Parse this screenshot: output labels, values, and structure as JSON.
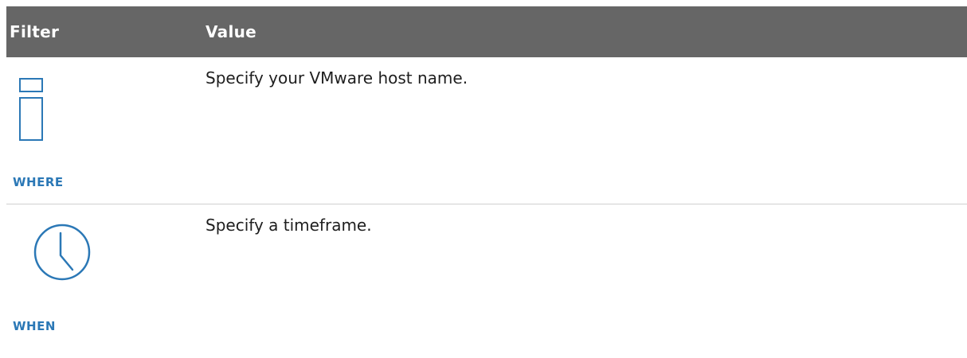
{
  "header": {
    "filter_label": "Filter",
    "value_label": "Value"
  },
  "rows": [
    {
      "icon": "host-panel-icon",
      "label": "WHERE",
      "value": "Specify your VMware host name."
    },
    {
      "icon": "clock-icon",
      "label": "WHEN",
      "value": "Specify a timeframe."
    }
  ],
  "colors": {
    "header_bg": "#666666",
    "accent": "#2b78b6",
    "divider": "#cfcfcf"
  }
}
